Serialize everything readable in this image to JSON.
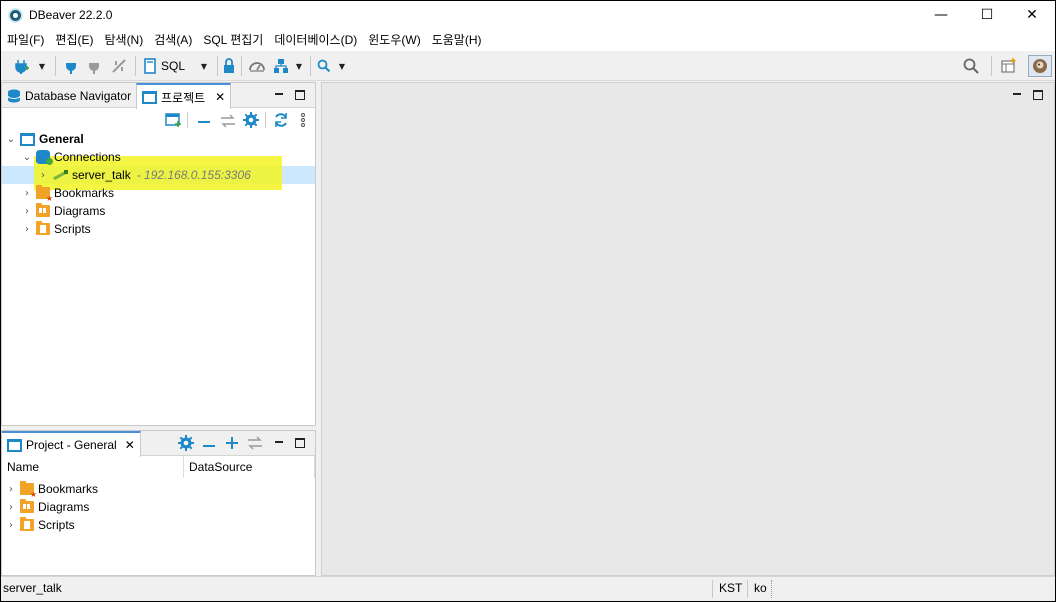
{
  "window": {
    "title": "DBeaver 22.2.0",
    "controls": [
      "—",
      "☐",
      "✕"
    ]
  },
  "menu": [
    "파일(F)",
    "편집(E)",
    "탐색(N)",
    "검색(A)",
    "SQL 편집기",
    "데이터베이스(D)",
    "윈도우(W)",
    "도움말(H)"
  ],
  "toolbar": {
    "sql_label": "SQL",
    "icons": [
      "new-connection-icon",
      "connect-icon",
      "disconnect-icon",
      "invalidate-icon",
      "sql-editor-icon",
      "transaction-lock-icon",
      "dashboard-icon",
      "schema-compare-icon",
      "search-icon",
      "global-search-icon",
      "perspective-icon",
      "user-avatar-icon"
    ]
  },
  "navigator": {
    "tabs": {
      "db_navigator": "Database Navigator",
      "projects": "프로젝트"
    },
    "tree": {
      "general": "General",
      "connections": "Connections",
      "server_name": "server_talk",
      "server_address": " - 192.168.0.155:3306",
      "bookmarks": "Bookmarks",
      "diagrams": "Diagrams",
      "scripts": "Scripts"
    }
  },
  "project_panel": {
    "tab": "Project - General",
    "columns": {
      "name": "Name",
      "datasource": "DataSource"
    },
    "items": {
      "bookmarks": "Bookmarks",
      "diagrams": "Diagrams",
      "scripts": "Scripts"
    }
  },
  "status": {
    "left": "server_talk",
    "timezone": "KST",
    "locale": "ko"
  },
  "colors": {
    "accent": "#1e88c8",
    "highlight": "#f2f522",
    "selection": "#cce8ff",
    "folder": "#f0a326"
  }
}
